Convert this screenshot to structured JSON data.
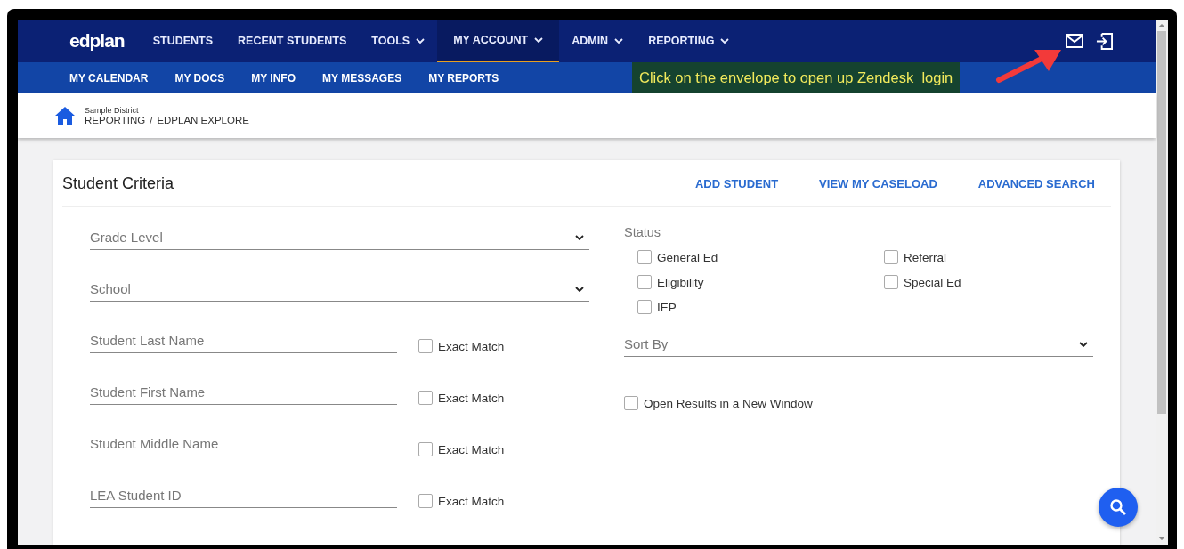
{
  "logo": "edplan",
  "main_nav": [
    {
      "label": "STUDENTS",
      "dropdown": false,
      "selected": false
    },
    {
      "label": "RECENT STUDENTS",
      "dropdown": false,
      "selected": false
    },
    {
      "label": "TOOLS",
      "dropdown": true,
      "selected": false
    },
    {
      "label": "MY ACCOUNT",
      "dropdown": true,
      "selected": true
    },
    {
      "label": "ADMIN",
      "dropdown": true,
      "selected": false
    },
    {
      "label": "REPORTING",
      "dropdown": true,
      "selected": false
    }
  ],
  "sub_nav": [
    "MY CALENDAR",
    "MY DOCS",
    "MY INFO",
    "MY MESSAGES",
    "MY REPORTS"
  ],
  "annotation": {
    "text": "Click on the envelope to open up Zendesk  login"
  },
  "breadcrumb": {
    "district": "Sample District",
    "path": [
      "REPORTING",
      "EDPLAN EXPLORE"
    ],
    "separator": "/"
  },
  "card": {
    "title": "Student Criteria",
    "actions": [
      "ADD STUDENT",
      "VIEW MY CASELOAD",
      "ADVANCED SEARCH"
    ]
  },
  "fields": [
    {
      "kind": "select",
      "placeholder": "Grade Level"
    },
    {
      "kind": "select",
      "placeholder": "School"
    },
    {
      "kind": "text",
      "placeholder": "Student Last Name",
      "exact_match": {
        "label": "Exact Match",
        "checked": false
      }
    },
    {
      "kind": "text",
      "placeholder": "Student First Name",
      "exact_match": {
        "label": "Exact Match",
        "checked": false
      }
    },
    {
      "kind": "text",
      "placeholder": "Student Middle Name",
      "exact_match": {
        "label": "Exact Match",
        "checked": false
      }
    },
    {
      "kind": "text",
      "placeholder": "LEA Student ID",
      "exact_match": {
        "label": "Exact Match",
        "checked": false
      }
    }
  ],
  "status": {
    "label": "Status",
    "options": [
      {
        "label": "General Ed",
        "checked": false
      },
      {
        "label": "Referral",
        "checked": false
      },
      {
        "label": "Eligibility",
        "checked": false
      },
      {
        "label": "Special Ed",
        "checked": false
      },
      {
        "label": "IEP",
        "checked": false
      }
    ]
  },
  "sort_by": {
    "placeholder": "Sort By"
  },
  "open_new_window": {
    "label": "Open Results in a New Window",
    "checked": false
  }
}
